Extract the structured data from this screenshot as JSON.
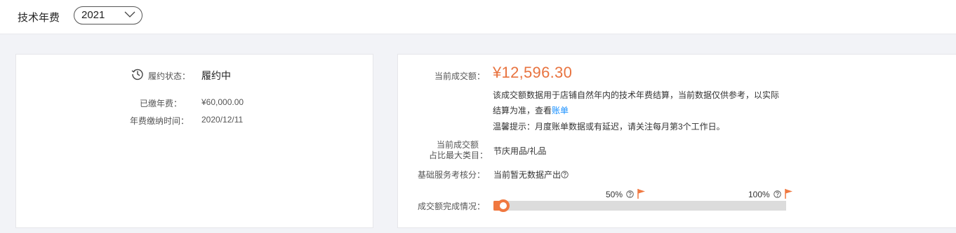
{
  "header": {
    "title": "技术年费",
    "year_select": {
      "selected": "2021"
    }
  },
  "left_card": {
    "status_label": "履约状态：",
    "status_value": "履约中",
    "paid_label": "已缴年费：",
    "paid_value": "¥60,000.00",
    "paid_time_label": "年费缴纳时间：",
    "paid_time_value": "2020/12/11"
  },
  "right_card": {
    "gmv_label": "当前成交额：",
    "gmv_value": "¥12,596.30",
    "desc_line1": "该成交额数据用于店铺自然年内的技术年费结算，当前数据仅供参考，以实际",
    "desc_line2_prefix": "结算为准，查看",
    "desc_link": "账单",
    "tip": "温馨提示：月度账单数据或有延迟，请关注每月第3个工作日。",
    "top_category_label_line1": "当前成交额",
    "top_category_label_line2": "占比最大类目：",
    "top_category_value": "节庆用品/礼品",
    "service_score_label": "基础服务考核分：",
    "service_score_value": "当前暂无数据产出",
    "progress_label": "成交额完成情况：",
    "milestone_50": "50%",
    "milestone_100": "100%",
    "progress_fraction": 0.0,
    "accent_color": "#f07840"
  },
  "icons": [
    "chevron-down-icon",
    "clock-history-icon",
    "help-icon",
    "flag-icon"
  ]
}
